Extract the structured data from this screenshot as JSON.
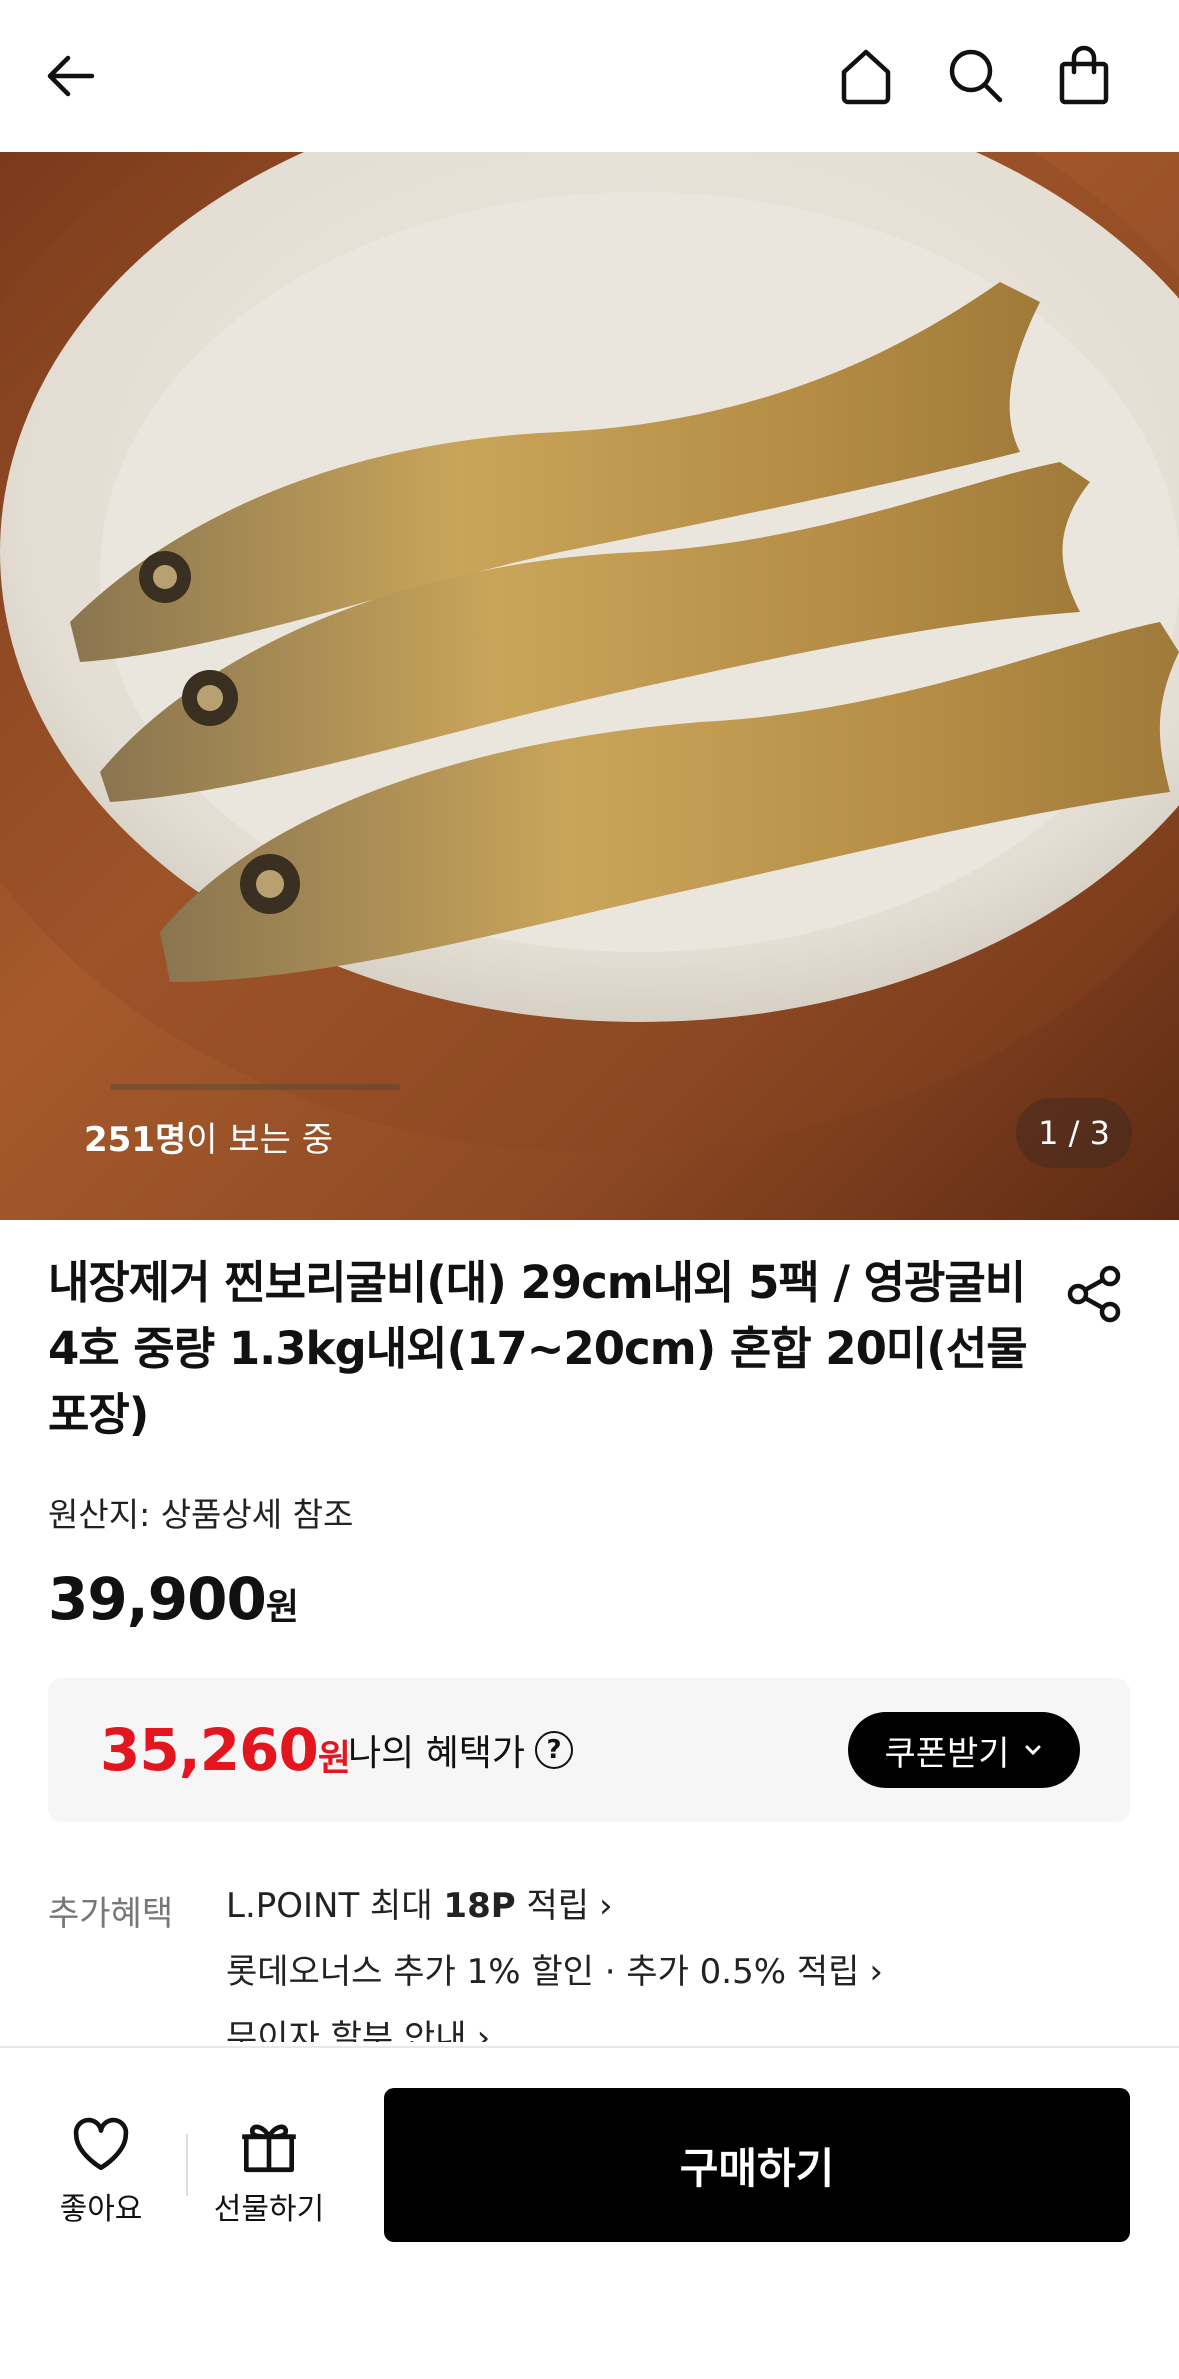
{
  "header": {
    "back_icon": "arrow-left-icon",
    "home_icon": "home-icon",
    "search_icon": "search-icon",
    "bag_icon": "shopping-bag-icon"
  },
  "hero": {
    "viewers_count": "251명",
    "viewers_suffix": "이 보는 중",
    "image_counter": "1 / 3"
  },
  "product": {
    "title": "내장제거 찐보리굴비(대) 29cm내외 5팩 / 영광굴비 4호 중량 1.3kg내외(17~20cm) 혼합 20미(선물포장)",
    "origin": "원산지: 상품상세 참조",
    "price": "39,900",
    "price_unit": "원"
  },
  "benefit": {
    "price": "35,260",
    "price_unit": "원",
    "label": "나의 혜택가",
    "help": "?",
    "coupon_button": "쿠폰받기",
    "accent_color": "#e3151e"
  },
  "extra": {
    "label": "추가혜택",
    "items": [
      {
        "pre": "L.POINT 최대 ",
        "bold": "18P",
        "post": " 적립"
      },
      {
        "pre": "롯데오너스 추가 1% 할인 · 추가 0.5% 적립",
        "bold": "",
        "post": ""
      },
      {
        "pre": "무이자 할부 안내",
        "bold": "",
        "post": ""
      }
    ]
  },
  "bottom": {
    "like_label": "좋아요",
    "gift_label": "선물하기",
    "buy_label": "구매하기"
  }
}
